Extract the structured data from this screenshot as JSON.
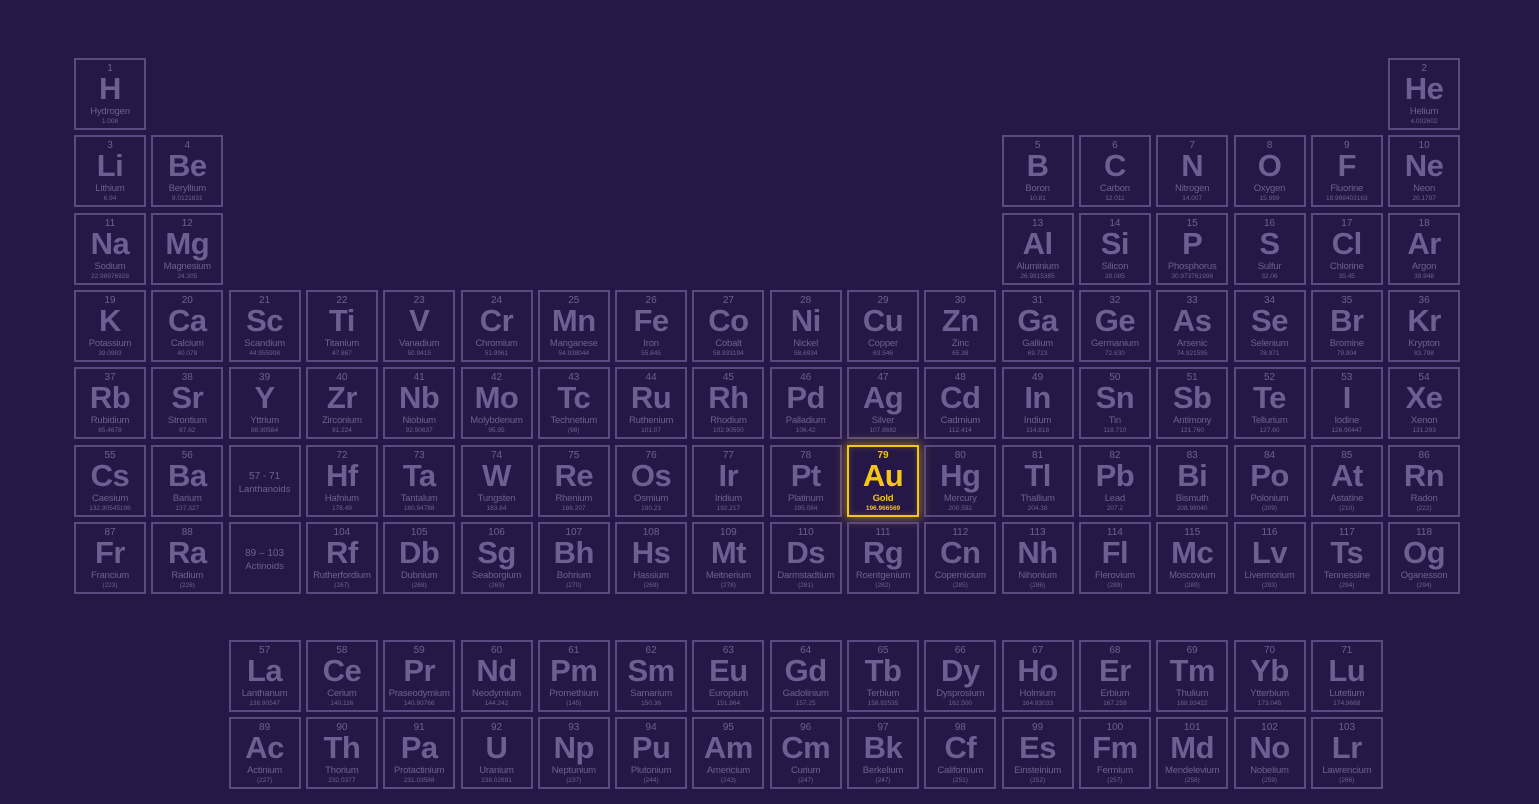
{
  "highlight_color": "#f5c518",
  "cell_color": "#6d5f91",
  "border_color": "#5b4a7f",
  "background_color": "#261846",
  "highlighted_symbol": "Au",
  "placeholders": [
    {
      "range": "57 - 71",
      "label": "Lanthanoids",
      "row": 6,
      "col": 3
    },
    {
      "range": "89 – 103",
      "label": "Actinoids",
      "row": 7,
      "col": 3
    }
  ],
  "elements": [
    {
      "n": "1",
      "s": "H",
      "name": "Hydrogen",
      "m": "1.008",
      "row": 1,
      "col": 1
    },
    {
      "n": "2",
      "s": "He",
      "name": "Helium",
      "m": "4.002602",
      "row": 1,
      "col": 18
    },
    {
      "n": "3",
      "s": "Li",
      "name": "Lithium",
      "m": "6.94",
      "row": 2,
      "col": 1
    },
    {
      "n": "4",
      "s": "Be",
      "name": "Beryllium",
      "m": "9.0121831",
      "row": 2,
      "col": 2
    },
    {
      "n": "5",
      "s": "B",
      "name": "Boron",
      "m": "10.81",
      "row": 2,
      "col": 13
    },
    {
      "n": "6",
      "s": "C",
      "name": "Carbon",
      "m": "12.011",
      "row": 2,
      "col": 14
    },
    {
      "n": "7",
      "s": "N",
      "name": "Nitrogen",
      "m": "14.007",
      "row": 2,
      "col": 15
    },
    {
      "n": "8",
      "s": "O",
      "name": "Oxygen",
      "m": "15.999",
      "row": 2,
      "col": 16
    },
    {
      "n": "9",
      "s": "F",
      "name": "Fluorine",
      "m": "18.998403163",
      "row": 2,
      "col": 17
    },
    {
      "n": "10",
      "s": "Ne",
      "name": "Neon",
      "m": "20.1797",
      "row": 2,
      "col": 18
    },
    {
      "n": "11",
      "s": "Na",
      "name": "Sodium",
      "m": "22.98976928",
      "row": 3,
      "col": 1
    },
    {
      "n": "12",
      "s": "Mg",
      "name": "Magnesium",
      "m": "24.305",
      "row": 3,
      "col": 2
    },
    {
      "n": "13",
      "s": "Al",
      "name": "Aluminium",
      "m": "26.9815385",
      "row": 3,
      "col": 13
    },
    {
      "n": "14",
      "s": "Si",
      "name": "Silicon",
      "m": "28.085",
      "row": 3,
      "col": 14
    },
    {
      "n": "15",
      "s": "P",
      "name": "Phosphorus",
      "m": "30.973761998",
      "row": 3,
      "col": 15
    },
    {
      "n": "16",
      "s": "S",
      "name": "Sulfur",
      "m": "32.06",
      "row": 3,
      "col": 16
    },
    {
      "n": "17",
      "s": "Cl",
      "name": "Chlorine",
      "m": "35.45",
      "row": 3,
      "col": 17
    },
    {
      "n": "18",
      "s": "Ar",
      "name": "Argon",
      "m": "39.948",
      "row": 3,
      "col": 18
    },
    {
      "n": "19",
      "s": "K",
      "name": "Potassium",
      "m": "39.0983",
      "row": 4,
      "col": 1
    },
    {
      "n": "20",
      "s": "Ca",
      "name": "Calcium",
      "m": "40.078",
      "row": 4,
      "col": 2
    },
    {
      "n": "21",
      "s": "Sc",
      "name": "Scandium",
      "m": "44.955908",
      "row": 4,
      "col": 3
    },
    {
      "n": "22",
      "s": "Ti",
      "name": "Titanium",
      "m": "47.867",
      "row": 4,
      "col": 4
    },
    {
      "n": "23",
      "s": "V",
      "name": "Vanadium",
      "m": "50.9415",
      "row": 4,
      "col": 5
    },
    {
      "n": "24",
      "s": "Cr",
      "name": "Chromium",
      "m": "51.9961",
      "row": 4,
      "col": 6
    },
    {
      "n": "25",
      "s": "Mn",
      "name": "Manganese",
      "m": "54.938044",
      "row": 4,
      "col": 7
    },
    {
      "n": "26",
      "s": "Fe",
      "name": "Iron",
      "m": "55.845",
      "row": 4,
      "col": 8
    },
    {
      "n": "27",
      "s": "Co",
      "name": "Cobalt",
      "m": "58.933194",
      "row": 4,
      "col": 9
    },
    {
      "n": "28",
      "s": "Ni",
      "name": "Nickel",
      "m": "58.6934",
      "row": 4,
      "col": 10
    },
    {
      "n": "29",
      "s": "Cu",
      "name": "Copper",
      "m": "63.546",
      "row": 4,
      "col": 11
    },
    {
      "n": "30",
      "s": "Zn",
      "name": "Zinc",
      "m": "65.38",
      "row": 4,
      "col": 12
    },
    {
      "n": "31",
      "s": "Ga",
      "name": "Gallium",
      "m": "69.723",
      "row": 4,
      "col": 13
    },
    {
      "n": "32",
      "s": "Ge",
      "name": "Germanium",
      "m": "72.630",
      "row": 4,
      "col": 14
    },
    {
      "n": "33",
      "s": "As",
      "name": "Arsenic",
      "m": "74.921595",
      "row": 4,
      "col": 15
    },
    {
      "n": "34",
      "s": "Se",
      "name": "Selenium",
      "m": "78.971",
      "row": 4,
      "col": 16
    },
    {
      "n": "35",
      "s": "Br",
      "name": "Bromine",
      "m": "79.904",
      "row": 4,
      "col": 17
    },
    {
      "n": "36",
      "s": "Kr",
      "name": "Krypton",
      "m": "83.798",
      "row": 4,
      "col": 18
    },
    {
      "n": "37",
      "s": "Rb",
      "name": "Rubidium",
      "m": "85.4678",
      "row": 5,
      "col": 1
    },
    {
      "n": "38",
      "s": "Sr",
      "name": "Strontium",
      "m": "87.62",
      "row": 5,
      "col": 2
    },
    {
      "n": "39",
      "s": "Y",
      "name": "Yttrium",
      "m": "88.90584",
      "row": 5,
      "col": 3
    },
    {
      "n": "40",
      "s": "Zr",
      "name": "Zirconium",
      "m": "91.224",
      "row": 5,
      "col": 4
    },
    {
      "n": "41",
      "s": "Nb",
      "name": "Niobium",
      "m": "92.90637",
      "row": 5,
      "col": 5
    },
    {
      "n": "42",
      "s": "Mo",
      "name": "Molybdenum",
      "m": "95.95",
      "row": 5,
      "col": 6
    },
    {
      "n": "43",
      "s": "Tc",
      "name": "Technetium",
      "m": "(98)",
      "row": 5,
      "col": 7
    },
    {
      "n": "44",
      "s": "Ru",
      "name": "Ruthenium",
      "m": "101.07",
      "row": 5,
      "col": 8
    },
    {
      "n": "45",
      "s": "Rh",
      "name": "Rhodium",
      "m": "102.90550",
      "row": 5,
      "col": 9
    },
    {
      "n": "46",
      "s": "Pd",
      "name": "Palladium",
      "m": "106.42",
      "row": 5,
      "col": 10
    },
    {
      "n": "47",
      "s": "Ag",
      "name": "Silver",
      "m": "107.8682",
      "row": 5,
      "col": 11
    },
    {
      "n": "48",
      "s": "Cd",
      "name": "Cadmium",
      "m": "112.414",
      "row": 5,
      "col": 12
    },
    {
      "n": "49",
      "s": "In",
      "name": "Indium",
      "m": "114.818",
      "row": 5,
      "col": 13
    },
    {
      "n": "50",
      "s": "Sn",
      "name": "Tin",
      "m": "118.710",
      "row": 5,
      "col": 14
    },
    {
      "n": "51",
      "s": "Sb",
      "name": "Antimony",
      "m": "121.760",
      "row": 5,
      "col": 15
    },
    {
      "n": "52",
      "s": "Te",
      "name": "Tellurium",
      "m": "127.60",
      "row": 5,
      "col": 16
    },
    {
      "n": "53",
      "s": "I",
      "name": "Iodine",
      "m": "126.90447",
      "row": 5,
      "col": 17
    },
    {
      "n": "54",
      "s": "Xe",
      "name": "Xenon",
      "m": "131.293",
      "row": 5,
      "col": 18
    },
    {
      "n": "55",
      "s": "Cs",
      "name": "Caesium",
      "m": "132.90545196",
      "row": 6,
      "col": 1
    },
    {
      "n": "56",
      "s": "Ba",
      "name": "Barium",
      "m": "137.327",
      "row": 6,
      "col": 2
    },
    {
      "n": "72",
      "s": "Hf",
      "name": "Hafnium",
      "m": "178.49",
      "row": 6,
      "col": 4
    },
    {
      "n": "73",
      "s": "Ta",
      "name": "Tantalum",
      "m": "180.94788",
      "row": 6,
      "col": 5
    },
    {
      "n": "74",
      "s": "W",
      "name": "Tungsten",
      "m": "183.84",
      "row": 6,
      "col": 6
    },
    {
      "n": "75",
      "s": "Re",
      "name": "Rhenium",
      "m": "186.207",
      "row": 6,
      "col": 7
    },
    {
      "n": "76",
      "s": "Os",
      "name": "Osmium",
      "m": "190.23",
      "row": 6,
      "col": 8
    },
    {
      "n": "77",
      "s": "Ir",
      "name": "Iridium",
      "m": "192.217",
      "row": 6,
      "col": 9
    },
    {
      "n": "78",
      "s": "Pt",
      "name": "Platinum",
      "m": "195.084",
      "row": 6,
      "col": 10
    },
    {
      "n": "79",
      "s": "Au",
      "name": "Gold",
      "m": "196.966569",
      "row": 6,
      "col": 11
    },
    {
      "n": "80",
      "s": "Hg",
      "name": "Mercury",
      "m": "200.592",
      "row": 6,
      "col": 12
    },
    {
      "n": "81",
      "s": "Tl",
      "name": "Thallium",
      "m": "204.38",
      "row": 6,
      "col": 13
    },
    {
      "n": "82",
      "s": "Pb",
      "name": "Lead",
      "m": "207.2",
      "row": 6,
      "col": 14
    },
    {
      "n": "83",
      "s": "Bi",
      "name": "Bismuth",
      "m": "208.98040",
      "row": 6,
      "col": 15
    },
    {
      "n": "84",
      "s": "Po",
      "name": "Polonium",
      "m": "(209)",
      "row": 6,
      "col": 16
    },
    {
      "n": "85",
      "s": "At",
      "name": "Astatine",
      "m": "(210)",
      "row": 6,
      "col": 17
    },
    {
      "n": "86",
      "s": "Rn",
      "name": "Radon",
      "m": "(222)",
      "row": 6,
      "col": 18
    },
    {
      "n": "87",
      "s": "Fr",
      "name": "Francium",
      "m": "(223)",
      "row": 7,
      "col": 1
    },
    {
      "n": "88",
      "s": "Ra",
      "name": "Radium",
      "m": "(226)",
      "row": 7,
      "col": 2
    },
    {
      "n": "104",
      "s": "Rf",
      "name": "Rutherfordium",
      "m": "(267)",
      "row": 7,
      "col": 4
    },
    {
      "n": "105",
      "s": "Db",
      "name": "Dubnium",
      "m": "(268)",
      "row": 7,
      "col": 5
    },
    {
      "n": "106",
      "s": "Sg",
      "name": "Seaborgium",
      "m": "(269)",
      "row": 7,
      "col": 6
    },
    {
      "n": "107",
      "s": "Bh",
      "name": "Bohrium",
      "m": "(270)",
      "row": 7,
      "col": 7
    },
    {
      "n": "108",
      "s": "Hs",
      "name": "Hassium",
      "m": "(269)",
      "row": 7,
      "col": 8
    },
    {
      "n": "109",
      "s": "Mt",
      "name": "Meitnerium",
      "m": "(278)",
      "row": 7,
      "col": 9
    },
    {
      "n": "110",
      "s": "Ds",
      "name": "Darmstadtium",
      "m": "(281)",
      "row": 7,
      "col": 10
    },
    {
      "n": "111",
      "s": "Rg",
      "name": "Roentgenium",
      "m": "(282)",
      "row": 7,
      "col": 11
    },
    {
      "n": "112",
      "s": "Cn",
      "name": "Copernicium",
      "m": "(285)",
      "row": 7,
      "col": 12
    },
    {
      "n": "113",
      "s": "Nh",
      "name": "Nihonium",
      "m": "(286)",
      "row": 7,
      "col": 13
    },
    {
      "n": "114",
      "s": "Fl",
      "name": "Flerovium",
      "m": "(289)",
      "row": 7,
      "col": 14
    },
    {
      "n": "115",
      "s": "Mc",
      "name": "Moscovium",
      "m": "(289)",
      "row": 7,
      "col": 15
    },
    {
      "n": "116",
      "s": "Lv",
      "name": "Livermorium",
      "m": "(293)",
      "row": 7,
      "col": 16
    },
    {
      "n": "117",
      "s": "Ts",
      "name": "Tennessine",
      "m": "(294)",
      "row": 7,
      "col": 17
    },
    {
      "n": "118",
      "s": "Og",
      "name": "Oganesson",
      "m": "(294)",
      "row": 7,
      "col": 18
    },
    {
      "n": "57",
      "s": "La",
      "name": "Lanthanum",
      "m": "138.90547",
      "row": 9,
      "col": 3
    },
    {
      "n": "58",
      "s": "Ce",
      "name": "Cerium",
      "m": "140.116",
      "row": 9,
      "col": 4
    },
    {
      "n": "59",
      "s": "Pr",
      "name": "Praseodymium",
      "m": "140.90766",
      "row": 9,
      "col": 5
    },
    {
      "n": "60",
      "s": "Nd",
      "name": "Neodymium",
      "m": "144.242",
      "row": 9,
      "col": 6
    },
    {
      "n": "61",
      "s": "Pm",
      "name": "Promethium",
      "m": "(145)",
      "row": 9,
      "col": 7
    },
    {
      "n": "62",
      "s": "Sm",
      "name": "Samarium",
      "m": "150.36",
      "row": 9,
      "col": 8
    },
    {
      "n": "63",
      "s": "Eu",
      "name": "Europium",
      "m": "151.964",
      "row": 9,
      "col": 9
    },
    {
      "n": "64",
      "s": "Gd",
      "name": "Gadolinium",
      "m": "157.25",
      "row": 9,
      "col": 10
    },
    {
      "n": "65",
      "s": "Tb",
      "name": "Terbium",
      "m": "158.92535",
      "row": 9,
      "col": 11
    },
    {
      "n": "66",
      "s": "Dy",
      "name": "Dysprosium",
      "m": "162.500",
      "row": 9,
      "col": 12
    },
    {
      "n": "67",
      "s": "Ho",
      "name": "Holmium",
      "m": "164.93033",
      "row": 9,
      "col": 13
    },
    {
      "n": "68",
      "s": "Er",
      "name": "Erbium",
      "m": "167.259",
      "row": 9,
      "col": 14
    },
    {
      "n": "69",
      "s": "Tm",
      "name": "Thulium",
      "m": "168.93422",
      "row": 9,
      "col": 15
    },
    {
      "n": "70",
      "s": "Yb",
      "name": "Ytterbium",
      "m": "173.045",
      "row": 9,
      "col": 16
    },
    {
      "n": "71",
      "s": "Lu",
      "name": "Lutetium",
      "m": "174.9668",
      "row": 9,
      "col": 17
    },
    {
      "n": "89",
      "s": "Ac",
      "name": "Actinium",
      "m": "(227)",
      "row": 10,
      "col": 3
    },
    {
      "n": "90",
      "s": "Th",
      "name": "Thorium",
      "m": "232.0377",
      "row": 10,
      "col": 4
    },
    {
      "n": "91",
      "s": "Pa",
      "name": "Protactinium",
      "m": "231.03588",
      "row": 10,
      "col": 5
    },
    {
      "n": "92",
      "s": "U",
      "name": "Uranium",
      "m": "238.02891",
      "row": 10,
      "col": 6
    },
    {
      "n": "93",
      "s": "Np",
      "name": "Neptunium",
      "m": "(237)",
      "row": 10,
      "col": 7
    },
    {
      "n": "94",
      "s": "Pu",
      "name": "Plutonium",
      "m": "(244)",
      "row": 10,
      "col": 8
    },
    {
      "n": "95",
      "s": "Am",
      "name": "Americium",
      "m": "(243)",
      "row": 10,
      "col": 9
    },
    {
      "n": "96",
      "s": "Cm",
      "name": "Curium",
      "m": "(247)",
      "row": 10,
      "col": 10
    },
    {
      "n": "97",
      "s": "Bk",
      "name": "Berkelium",
      "m": "(247)",
      "row": 10,
      "col": 11
    },
    {
      "n": "98",
      "s": "Cf",
      "name": "Californium",
      "m": "(251)",
      "row": 10,
      "col": 12
    },
    {
      "n": "99",
      "s": "Es",
      "name": "Einsteinium",
      "m": "(252)",
      "row": 10,
      "col": 13
    },
    {
      "n": "100",
      "s": "Fm",
      "name": "Fermium",
      "m": "(257)",
      "row": 10,
      "col": 14
    },
    {
      "n": "101",
      "s": "Md",
      "name": "Mendelevium",
      "m": "(258)",
      "row": 10,
      "col": 15
    },
    {
      "n": "102",
      "s": "No",
      "name": "Nobelium",
      "m": "(259)",
      "row": 10,
      "col": 16
    },
    {
      "n": "103",
      "s": "Lr",
      "name": "Lawrencium",
      "m": "(266)",
      "row": 10,
      "col": 17
    }
  ]
}
